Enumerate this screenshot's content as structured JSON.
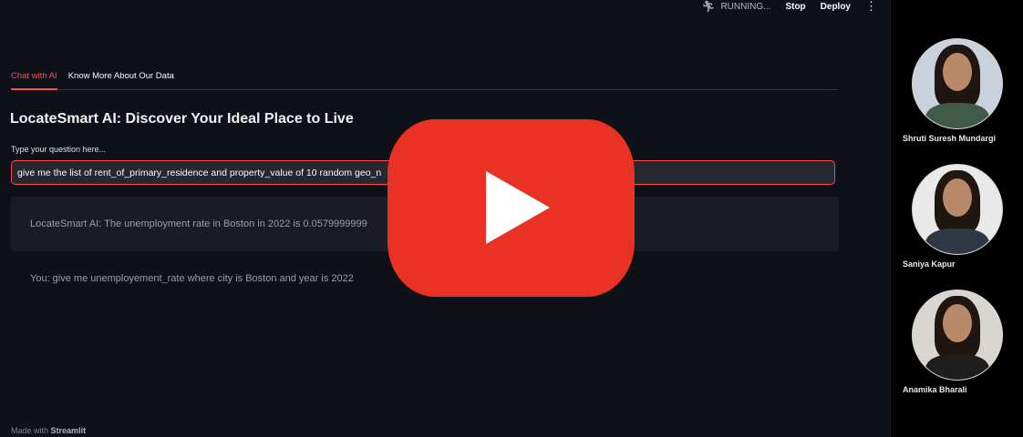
{
  "topbar": {
    "running_label": "RUNNING...",
    "stop_label": "Stop",
    "deploy_label": "Deploy",
    "menu_icon": "kebab-menu-icon"
  },
  "tabs": [
    {
      "label": "Chat with AI",
      "active": true
    },
    {
      "label": "Know More About Our Data",
      "active": false
    }
  ],
  "main": {
    "title": "LocateSmart AI: Discover Your Ideal Place to Live",
    "question_label": "Type your question here...",
    "question_value": "give me the list of rent_of_primary_residence and property_value of 10 random geo_n",
    "ai_message": "LocateSmart AI: The unemployment rate in Boston in 2022 is 0.0579999999",
    "user_message": "You: give me unemployement_rate where city is Boston and year is 2022"
  },
  "footer": {
    "prefix": "Made with",
    "brand": "Streamlit"
  },
  "video_overlay": {
    "icon": "youtube-play-icon",
    "color": "#ea3224"
  },
  "participants": [
    {
      "name": "Shruti Suresh Mundargi"
    },
    {
      "name": "Saniya Kapur"
    },
    {
      "name": "Anamika Bharali"
    }
  ],
  "colors": {
    "accent": "#ff4b4b",
    "background": "#0e1117",
    "input_bg": "#262730"
  }
}
